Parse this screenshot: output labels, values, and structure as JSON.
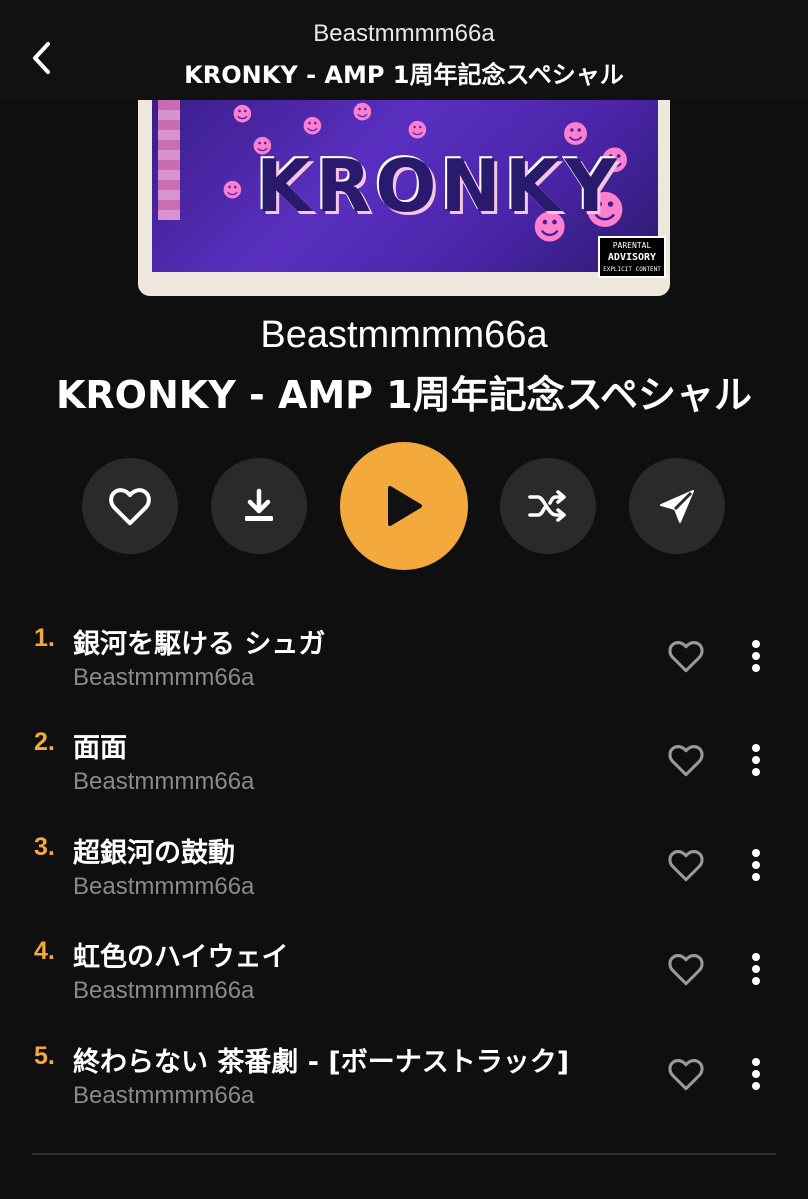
{
  "header": {
    "artist": "Beastmmmm66a",
    "album": "KRONKY - AMP 1周年記念スペシャル",
    "back_icon": "chevron-left-icon"
  },
  "cover": {
    "title_text": "KRONKY",
    "advisory_lines": [
      "PARENTAL",
      "ADVISORY",
      "EXPLICIT CONTENT"
    ]
  },
  "hero": {
    "artist": "Beastmmmm66a",
    "album": "KRONKY - AMP 1周年記念スペシャル"
  },
  "actions": {
    "favorite_icon": "heart-outline-icon",
    "download_icon": "download-icon",
    "play_icon": "play-icon",
    "shuffle_icon": "shuffle-icon",
    "share_icon": "send-icon",
    "accent_color": "#f3a93c"
  },
  "tracks": [
    {
      "number": "1.",
      "title": "銀河を駆ける シュガ",
      "artist": "Beastmmmm66a"
    },
    {
      "number": "2.",
      "title": "面面",
      "artist": "Beastmmmm66a"
    },
    {
      "number": "3.",
      "title": "超銀河の鼓動",
      "artist": "Beastmmmm66a"
    },
    {
      "number": "4.",
      "title": "虹色のハイウェイ",
      "artist": "Beastmmmm66a"
    },
    {
      "number": "5.",
      "title": "終わらない 茶番劇 - [ボーナストラック]",
      "artist": "Beastmmmm66a"
    }
  ]
}
